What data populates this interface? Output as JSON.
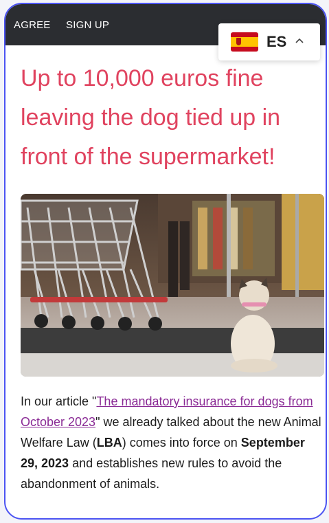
{
  "topbar": {
    "agree_label": "AGREE",
    "signup_label": "SIGN UP"
  },
  "language": {
    "code": "ES",
    "flag": "spain-flag-icon",
    "chevron": "chevron-up-icon"
  },
  "headline": "Up to 10,000 euros fine leaving the dog tied up in front of the supermarket!",
  "image": {
    "subject": "pug tied in front of supermarket entrance with shopping carts"
  },
  "article": {
    "text_1": "In our article \"",
    "link_text": "The mandatory insurance for dogs from October 2023",
    "text_2": "\" we already talked about the new Animal Welfare Law (",
    "law_abbr": "LBA",
    "text_3": ") comes into force on ",
    "date": "September 29, 2023",
    "text_4": " and establishes new rules to avoid the abandonment of animals."
  },
  "colors": {
    "headline": "#e0435f",
    "link": "#8a2a95",
    "frame": "#4b53f2",
    "topbar": "#2b2d31"
  }
}
